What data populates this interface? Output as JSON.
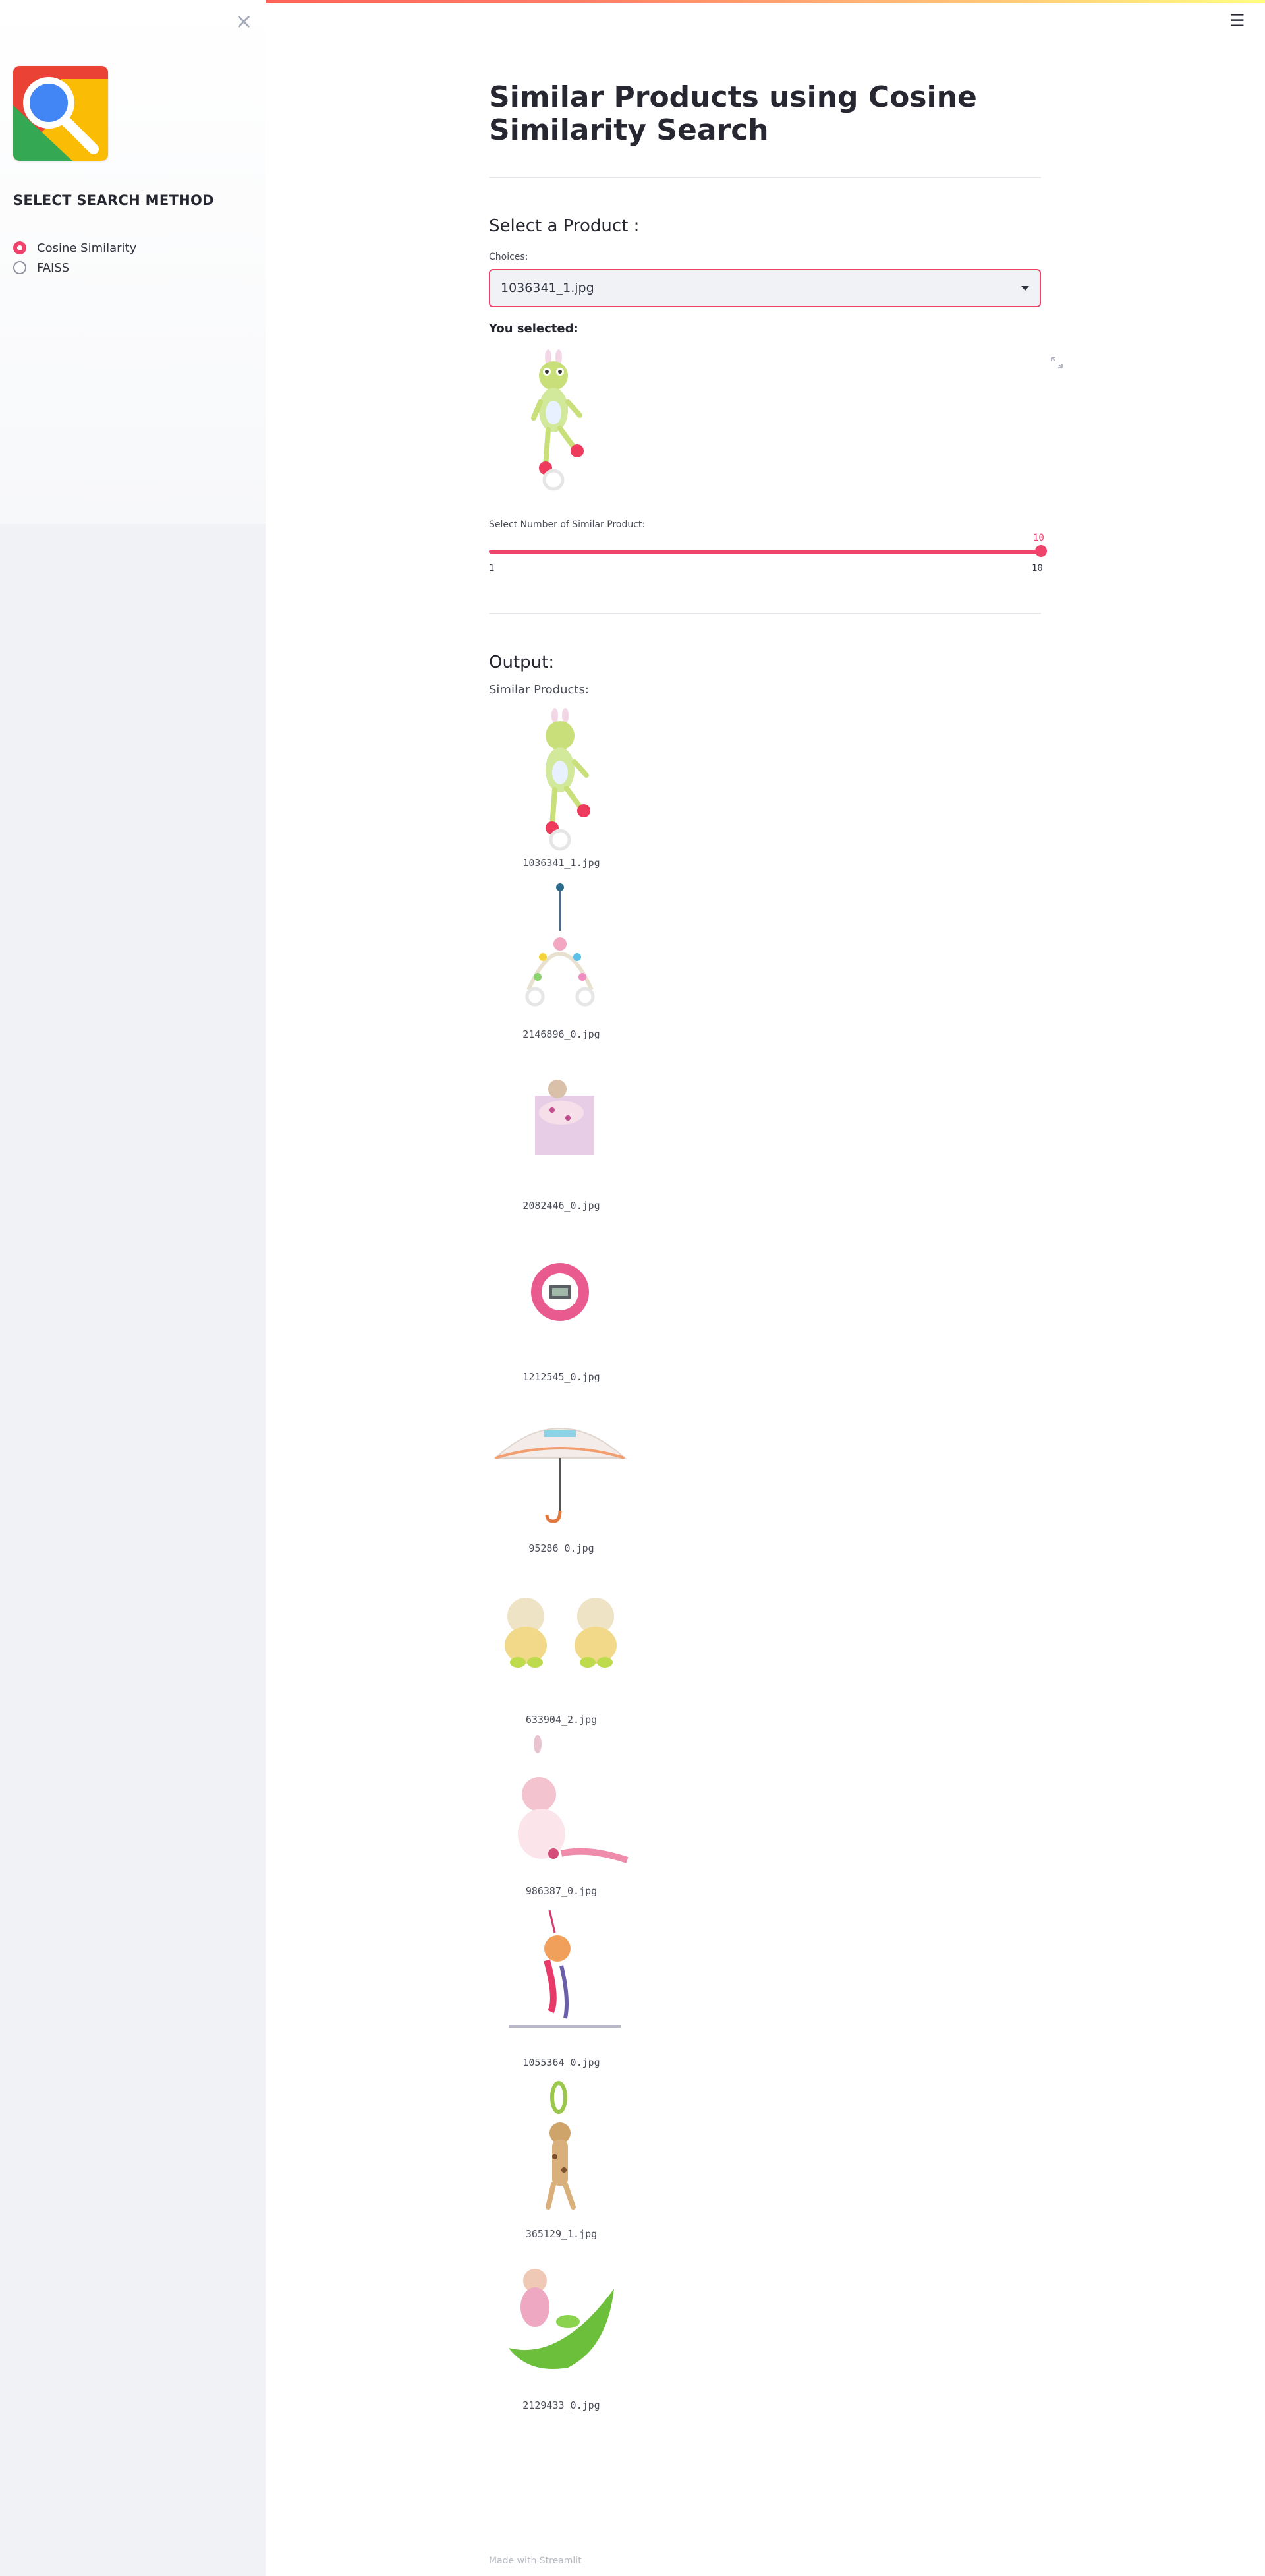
{
  "sidebar": {
    "close_icon": "close-icon",
    "logo_icon": "magnifier-logo",
    "title": "SELECT SEARCH METHOD",
    "options": [
      {
        "label": "Cosine Similarity",
        "checked": true
      },
      {
        "label": "FAISS",
        "checked": false
      }
    ]
  },
  "header": {
    "menu_icon": "hamburger-menu-icon"
  },
  "main": {
    "title": "Similar Products using Cosine Similarity Search",
    "select_heading": "Select a Product :",
    "choices_label": "Choices:",
    "selected_value": "1036341_1.jpg",
    "you_selected_label": "You selected:",
    "slider": {
      "label": "Select Number of Similar Product:",
      "value": "10",
      "min": "1",
      "max": "10",
      "fraction": 1.0
    },
    "output_heading": "Output:",
    "similar_label": "Similar Products:",
    "results": [
      "1036341_1.jpg",
      "2146896_0.jpg",
      "2082446_0.jpg",
      "1212545_0.jpg",
      "95286_0.jpg",
      "633904_2.jpg",
      "986387_0.jpg",
      "1055364_0.jpg",
      "365129_1.jpg",
      "2129433_0.jpg"
    ]
  },
  "footer": {
    "text": "Made with Streamlit"
  },
  "colors": {
    "accent": "#f0426b",
    "sidebar_bg": "#f0f2f6",
    "text": "#262730"
  }
}
